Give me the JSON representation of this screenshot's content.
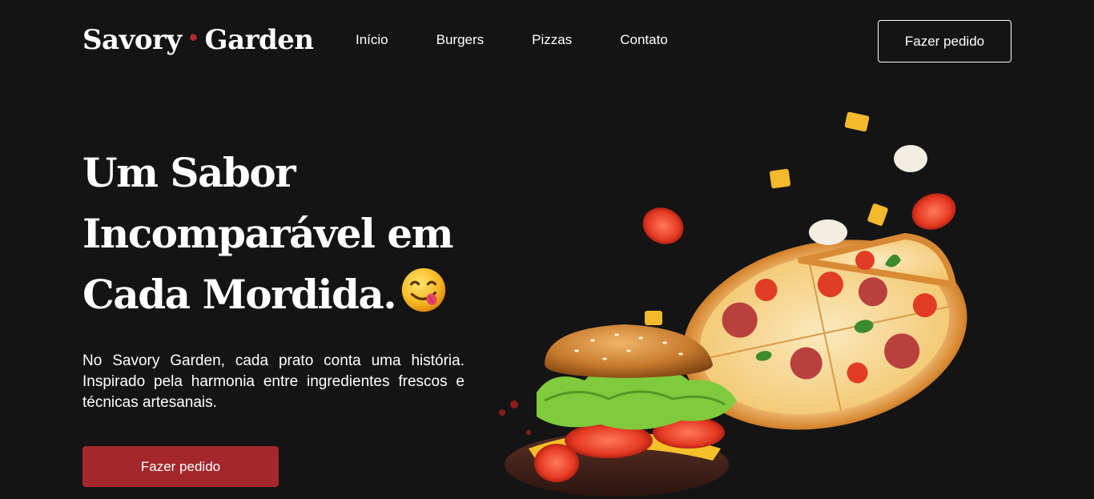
{
  "brand": {
    "name_part1": "Savory",
    "separator": "•",
    "name_part2": "Garden",
    "accent_color": "#b3282d"
  },
  "nav": {
    "items": [
      "Início",
      "Burgers",
      "Pizzas",
      "Contato"
    ]
  },
  "header": {
    "cta_label": "Fazer pedido"
  },
  "hero": {
    "title": "Um Sabor Incomparável em Cada Mordida.",
    "emoji_icon": "yum-face-emoji",
    "description": "No Savory Garden, cada prato conta uma história. Inspirado pela harmonia entre ingredientes frescos e técnicas artesanais.",
    "cta_label": "Fazer pedido",
    "cta_color": "#a3272b"
  },
  "colors": {
    "background": "#141414",
    "text": "#ffffff"
  }
}
